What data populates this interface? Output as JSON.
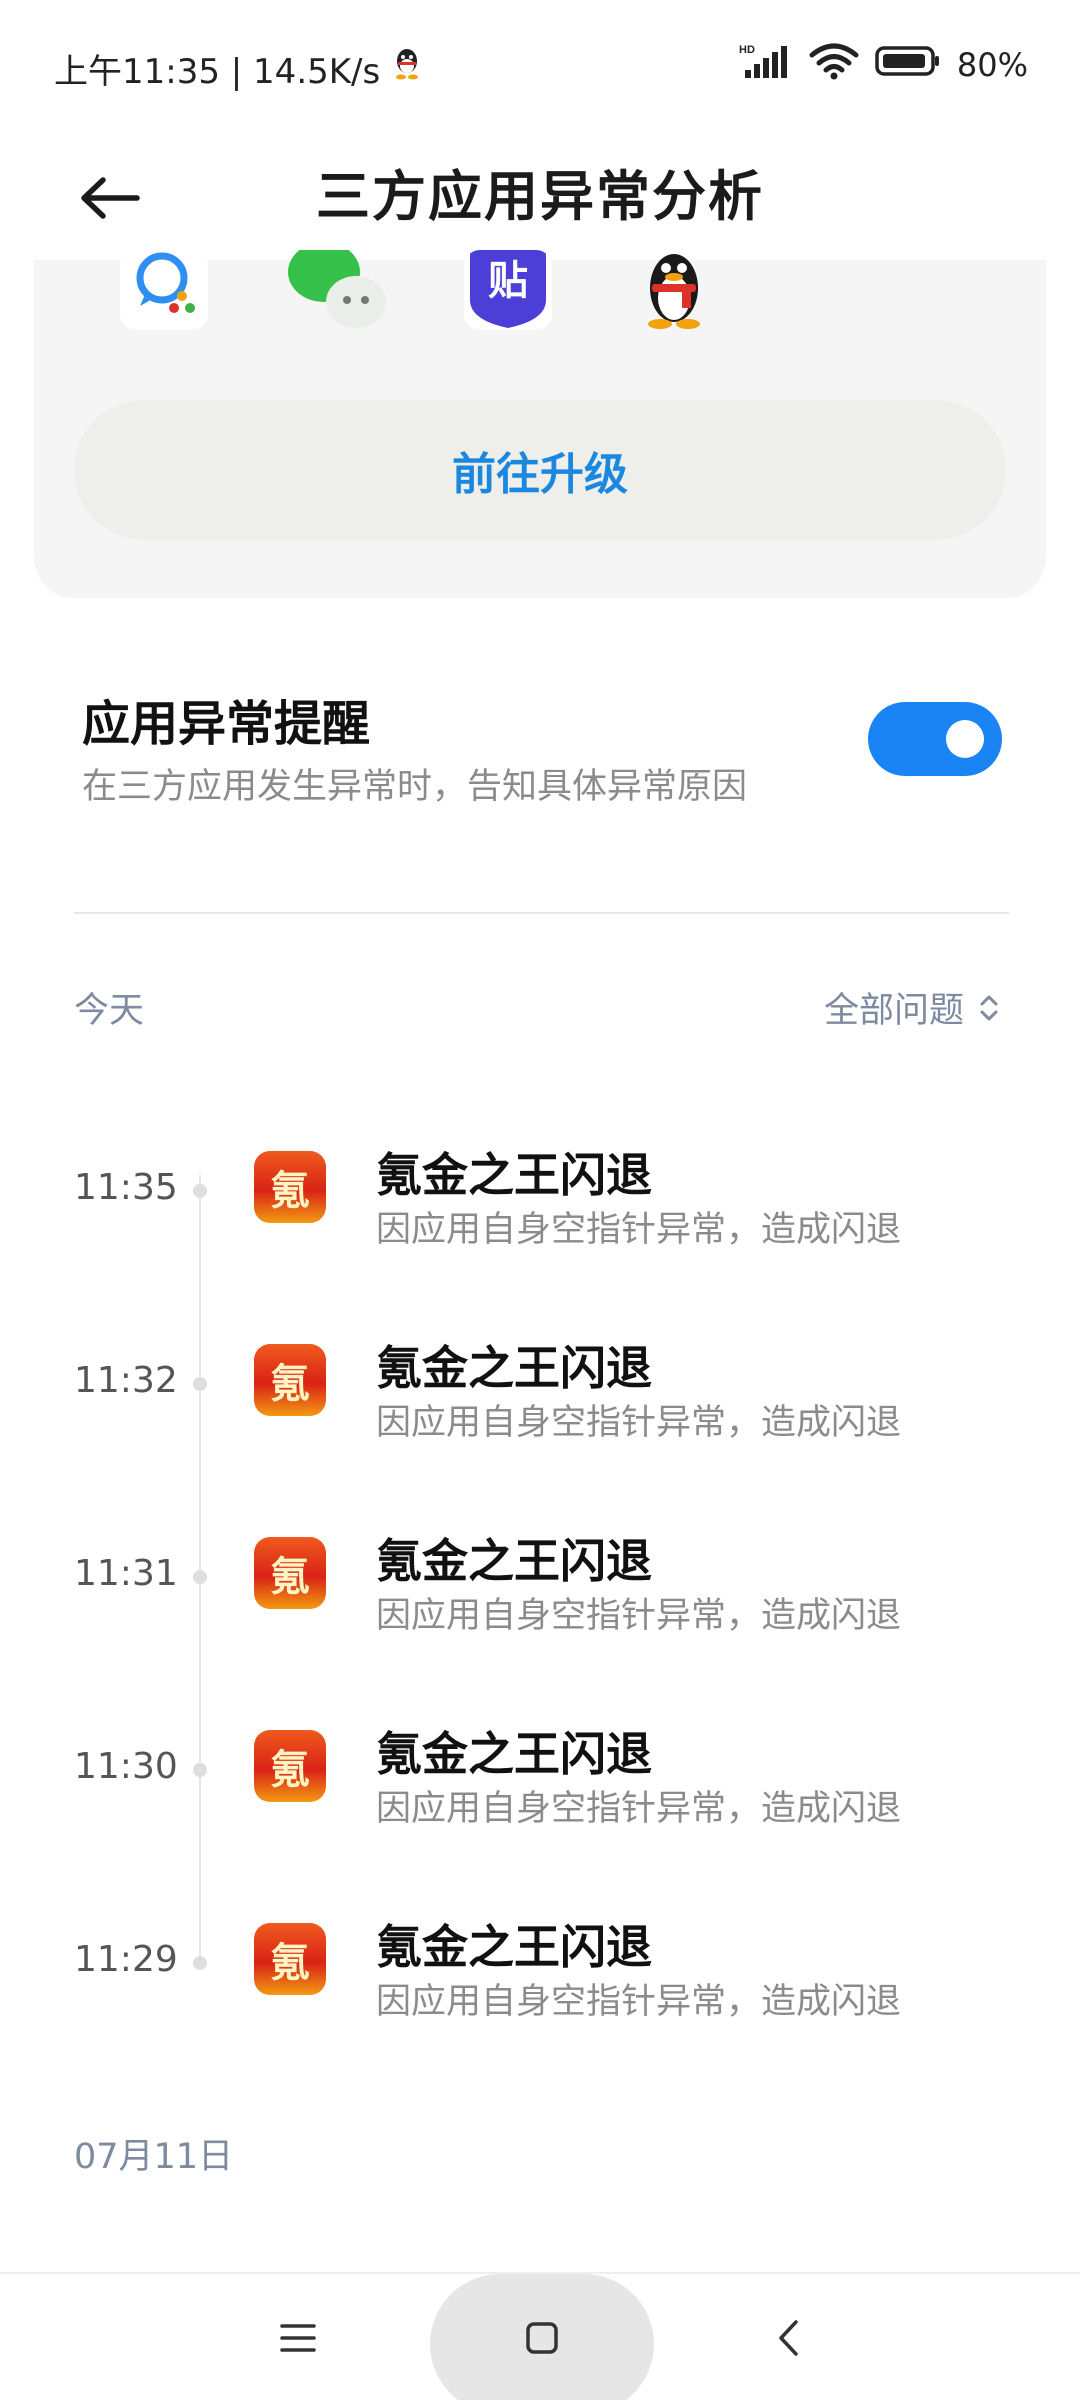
{
  "status_bar": {
    "time_speed": "上午11:35 | 14.5K/s",
    "network_type": "HD",
    "battery": "80%",
    "icons": [
      "qq-icon",
      "signal-icon",
      "wifi-icon",
      "battery-icon"
    ]
  },
  "header": {
    "title": "三方应用异常分析",
    "back_icon": "back-arrow-icon"
  },
  "upgrade_card": {
    "app_icons": [
      "tim-icon",
      "wechat-icon",
      "tieba-icon",
      "qq-icon"
    ],
    "upgrade_label": "前往升级"
  },
  "alert_setting": {
    "title": "应用异常提醒",
    "description": "在三方应用发生异常时，告知具体异常原因",
    "enabled": true
  },
  "today_section": {
    "label": "今天",
    "filter_label": "全部问题"
  },
  "items": [
    {
      "time": "11:35",
      "title": "氪金之王闪退",
      "desc": "因应用自身空指针异常，造成闪退",
      "logo_char": "氪"
    },
    {
      "time": "11:32",
      "title": "氪金之王闪退",
      "desc": "因应用自身空指针异常，造成闪退",
      "logo_char": "氪"
    },
    {
      "time": "11:31",
      "title": "氪金之王闪退",
      "desc": "因应用自身空指针异常，造成闪退",
      "logo_char": "氪"
    },
    {
      "time": "11:30",
      "title": "氪金之王闪退",
      "desc": "因应用自身空指针异常，造成闪退",
      "logo_char": "氪"
    },
    {
      "time": "11:29",
      "title": "氪金之王闪退",
      "desc": "因应用自身空指针异常，造成闪退",
      "logo_char": "氪"
    }
  ],
  "older_section": {
    "label": "07月11日"
  },
  "colors": {
    "accent": "#1b84f5",
    "link": "#1b88e0",
    "secondary_text": "#8b8b8b",
    "section_text": "#7d8a9f"
  }
}
